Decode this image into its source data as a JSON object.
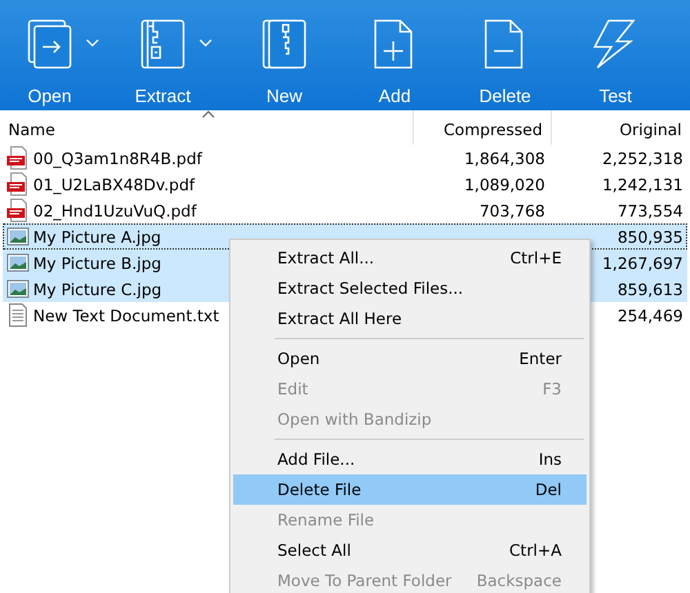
{
  "toolbar": [
    {
      "kind": "open",
      "label": "Open",
      "dropdown": true
    },
    {
      "kind": "extract",
      "label": "Extract",
      "dropdown": true
    },
    {
      "kind": "new",
      "label": "New",
      "dropdown": false
    },
    {
      "kind": "add",
      "label": "Add",
      "dropdown": false
    },
    {
      "kind": "delete",
      "label": "Delete",
      "dropdown": false
    },
    {
      "kind": "test",
      "label": "Test",
      "dropdown": false
    }
  ],
  "table": {
    "columns": [
      {
        "label": "Name",
        "sorted": true
      },
      {
        "label": "Compressed",
        "sorted": false
      },
      {
        "label": "Original",
        "sorted": false
      }
    ],
    "rows": [
      {
        "kind": "pdf",
        "name": "00_Q3am1n8R4B.pdf",
        "compressed": "1,864,308",
        "original": "2,252,318",
        "selected": false,
        "focused": false
      },
      {
        "kind": "pdf",
        "name": "01_U2LaBX48Dv.pdf",
        "compressed": "1,089,020",
        "original": "1,242,131",
        "selected": false,
        "focused": false
      },
      {
        "kind": "pdf",
        "name": "02_Hnd1UzuVuQ.pdf",
        "compressed": "703,768",
        "original": "773,554",
        "selected": false,
        "focused": false
      },
      {
        "kind": "image",
        "name": "My Picture A.jpg",
        "original": "850,935",
        "selected": true,
        "focused": true
      },
      {
        "kind": "image",
        "name": "My Picture B.jpg",
        "original": "1,267,697",
        "selected": true,
        "focused": false
      },
      {
        "kind": "image",
        "name": "My Picture C.jpg",
        "original": "859,613",
        "selected": true,
        "focused": false
      },
      {
        "kind": "text",
        "name": "New Text Document.txt",
        "original": "254,469",
        "selected": false,
        "focused": false
      }
    ]
  },
  "context_menu": {
    "items": [
      {
        "kind": "item",
        "label": "Extract All...",
        "shortcut": "Ctrl+E",
        "disabled": false,
        "selected": false
      },
      {
        "kind": "item",
        "label": "Extract Selected Files...",
        "disabled": false,
        "selected": false
      },
      {
        "kind": "item",
        "label": "Extract All Here",
        "disabled": false,
        "selected": false
      },
      {
        "kind": "separator"
      },
      {
        "kind": "item",
        "label": "Open",
        "shortcut": "Enter",
        "disabled": false,
        "selected": false
      },
      {
        "kind": "item",
        "label": "Edit",
        "shortcut": "F3",
        "disabled": true,
        "selected": false
      },
      {
        "kind": "item",
        "label": "Open with Bandizip",
        "disabled": true,
        "selected": false
      },
      {
        "kind": "separator"
      },
      {
        "kind": "item",
        "label": "Add File...",
        "shortcut": "Ins",
        "disabled": false,
        "selected": false
      },
      {
        "kind": "item",
        "label": "Delete File",
        "shortcut": "Del",
        "disabled": false,
        "selected": true
      },
      {
        "kind": "item",
        "label": "Rename File",
        "disabled": true,
        "selected": false
      },
      {
        "kind": "item",
        "label": "Select All",
        "shortcut": "Ctrl+A",
        "disabled": false,
        "selected": false
      },
      {
        "kind": "item",
        "label": "Move To Parent Folder",
        "shortcut": "Backspace",
        "disabled": true,
        "selected": false
      }
    ]
  }
}
